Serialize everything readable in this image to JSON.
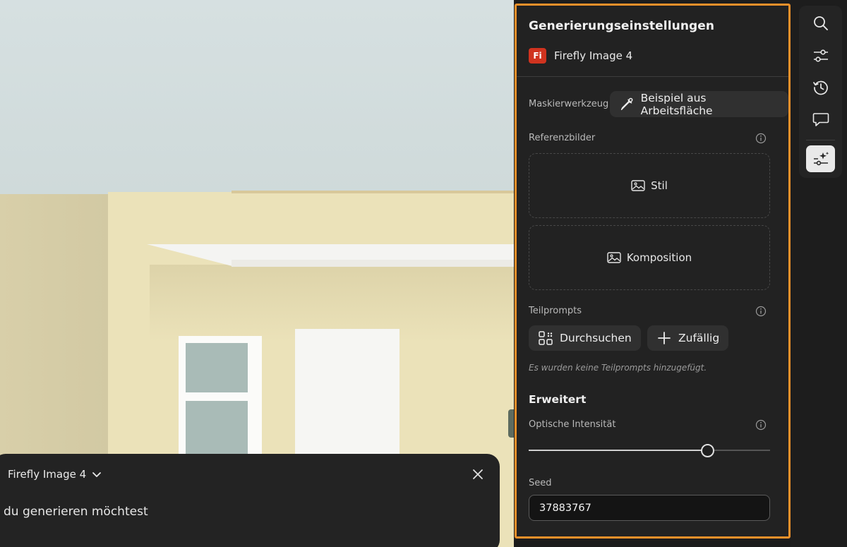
{
  "prompt_bar": {
    "model_label": "Firefly Image 4",
    "prompt_text": "du generieren möchtest"
  },
  "panel": {
    "title": "Generierungseinstellungen",
    "model_badge": "Fi",
    "model_name": "Firefly Image 4",
    "mask_tool": {
      "label": "Maskierwerkzeug",
      "button_label": "Beispiel aus Arbeitsfläche"
    },
    "reference_images": {
      "label": "Referenzbilder",
      "style_label": "Stil",
      "composition_label": "Komposition"
    },
    "partial_prompts": {
      "label": "Teilprompts",
      "browse_label": "Durchsuchen",
      "random_label": "Zufällig",
      "empty_hint": "Es wurden keine Teilprompts hinzugefügt."
    },
    "advanced": {
      "heading": "Erweitert",
      "visual_intensity_label": "Optische Intensität",
      "visual_intensity_value": 0.74,
      "seed_label": "Seed",
      "seed_value": "37883767"
    }
  },
  "toolbar": {
    "tools": [
      "search-icon",
      "sliders-icon",
      "history-icon",
      "comment-icon",
      "generate-settings-icon"
    ],
    "active_tool": "generate-settings-icon"
  },
  "colors": {
    "panel_highlight": "#f0902a",
    "badge": "#d0331f",
    "panel_bg": "#222222"
  }
}
